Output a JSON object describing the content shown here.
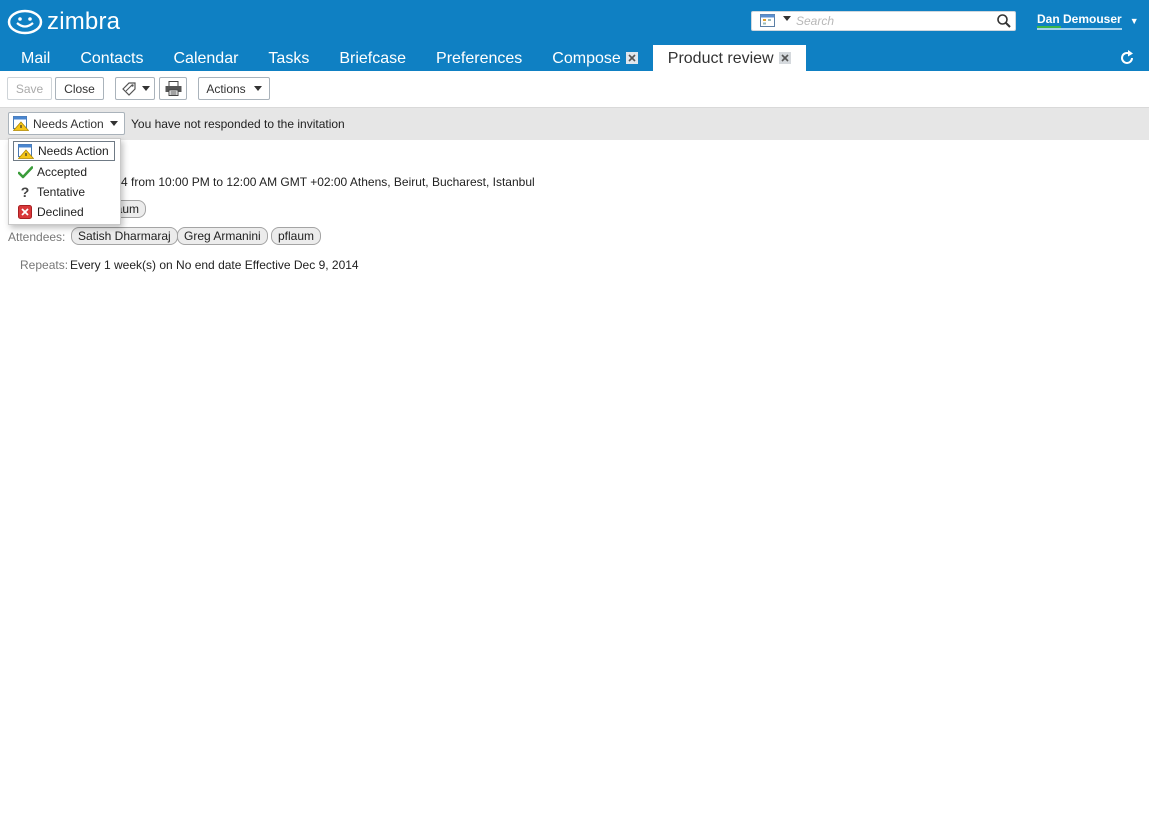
{
  "app": {
    "brand": "zimbra"
  },
  "search": {
    "placeholder": "Search"
  },
  "user": {
    "name": "Dan Demouser"
  },
  "tabs": [
    {
      "label": "Mail"
    },
    {
      "label": "Contacts"
    },
    {
      "label": "Calendar"
    },
    {
      "label": "Tasks"
    },
    {
      "label": "Briefcase"
    },
    {
      "label": "Preferences"
    },
    {
      "label": "Compose",
      "closable": true
    },
    {
      "label": "Product review",
      "closable": true,
      "active": true
    }
  ],
  "toolbar": {
    "save_label": "Save",
    "close_label": "Close",
    "actions_label": "Actions"
  },
  "invite": {
    "status_label": "Needs Action",
    "message": "You have not responded to the invitation"
  },
  "menu": {
    "items": [
      {
        "label": "Needs Action",
        "icon": "needs-action-icon",
        "selected": true
      },
      {
        "label": "Accepted",
        "icon": "check-icon"
      },
      {
        "label": "Tentative",
        "icon": "question-icon"
      },
      {
        "label": "Declined",
        "icon": "declined-x-icon"
      }
    ]
  },
  "details": {
    "time_partial": "4 from 10:00 PM to 12:00 AM GMT +02:00 Athens, Beirut, Bucharest, Istanbul",
    "organizer_partial": "laum",
    "attendees_label": "Attendees:",
    "attendees": [
      "Satish Dharmaraj",
      "Greg Armanini",
      "pflaum"
    ],
    "repeats_label": "Repeats:",
    "repeats_value": "Every 1 week(s) on No end date Effective Dec 9, 2014"
  },
  "colors": {
    "header_blue": "#0f80c3",
    "accept_green": "#3a9c3a",
    "decline_red": "#d9383a"
  }
}
